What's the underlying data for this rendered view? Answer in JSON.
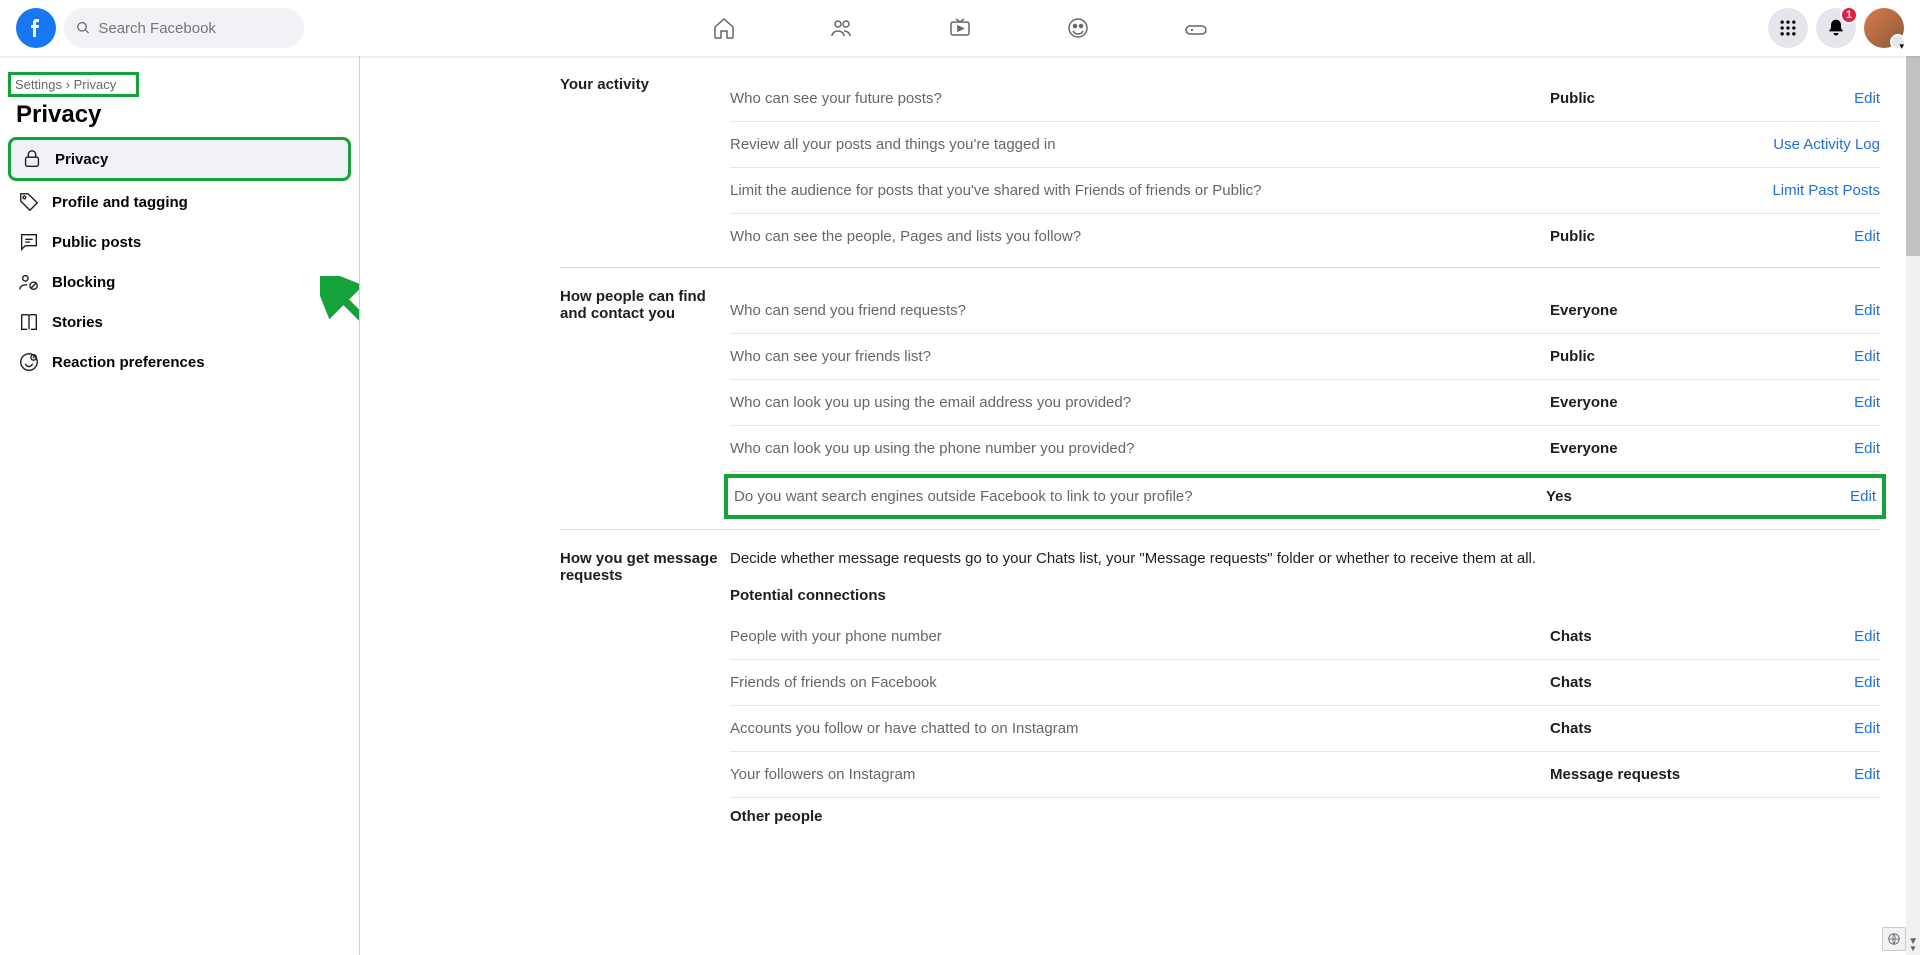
{
  "search": {
    "placeholder": "Search Facebook"
  },
  "badge": {
    "notifications": "1"
  },
  "breadcrumb": {
    "settings": "Settings",
    "sep": "›",
    "privacy": "Privacy"
  },
  "pageTitle": "Privacy",
  "sidebar": {
    "items": [
      {
        "label": "Privacy"
      },
      {
        "label": "Profile and tagging"
      },
      {
        "label": "Public posts"
      },
      {
        "label": "Blocking"
      },
      {
        "label": "Stories"
      },
      {
        "label": "Reaction preferences"
      }
    ]
  },
  "sections": {
    "activity": {
      "title": "Your activity",
      "rows": [
        {
          "label": "Who can see your future posts?",
          "value": "Public",
          "action": "Edit"
        },
        {
          "label": "Review all your posts and things you're tagged in",
          "value": "",
          "action": "Use Activity Log"
        },
        {
          "label": "Limit the audience for posts that you've shared with Friends of friends or Public?",
          "value": "",
          "action": "Limit Past Posts"
        },
        {
          "label": "Who can see the people, Pages and lists you follow?",
          "value": "Public",
          "action": "Edit"
        }
      ]
    },
    "contact": {
      "title": "How people can find and contact you",
      "rows": [
        {
          "label": "Who can send you friend requests?",
          "value": "Everyone",
          "action": "Edit"
        },
        {
          "label": "Who can see your friends list?",
          "value": "Public",
          "action": "Edit"
        },
        {
          "label": "Who can look you up using the email address you provided?",
          "value": "Everyone",
          "action": "Edit"
        },
        {
          "label": "Who can look you up using the phone number you provided?",
          "value": "Everyone",
          "action": "Edit"
        },
        {
          "label": "Do you want search engines outside Facebook to link to your profile?",
          "value": "Yes",
          "action": "Edit"
        }
      ]
    },
    "messages": {
      "title": "How you get message requests",
      "desc": "Decide whether message requests go to your Chats list, your \"Message requests\" folder or whether to receive them at all.",
      "subPotential": "Potential connections",
      "potentialRows": [
        {
          "label": "People with your phone number",
          "value": "Chats",
          "action": "Edit"
        },
        {
          "label": "Friends of friends on Facebook",
          "value": "Chats",
          "action": "Edit"
        },
        {
          "label": "Accounts you follow or have chatted to on Instagram",
          "value": "Chats",
          "action": "Edit"
        },
        {
          "label": "Your followers on Instagram",
          "value": "Message requests",
          "action": "Edit"
        }
      ],
      "subOther": "Other people"
    }
  }
}
